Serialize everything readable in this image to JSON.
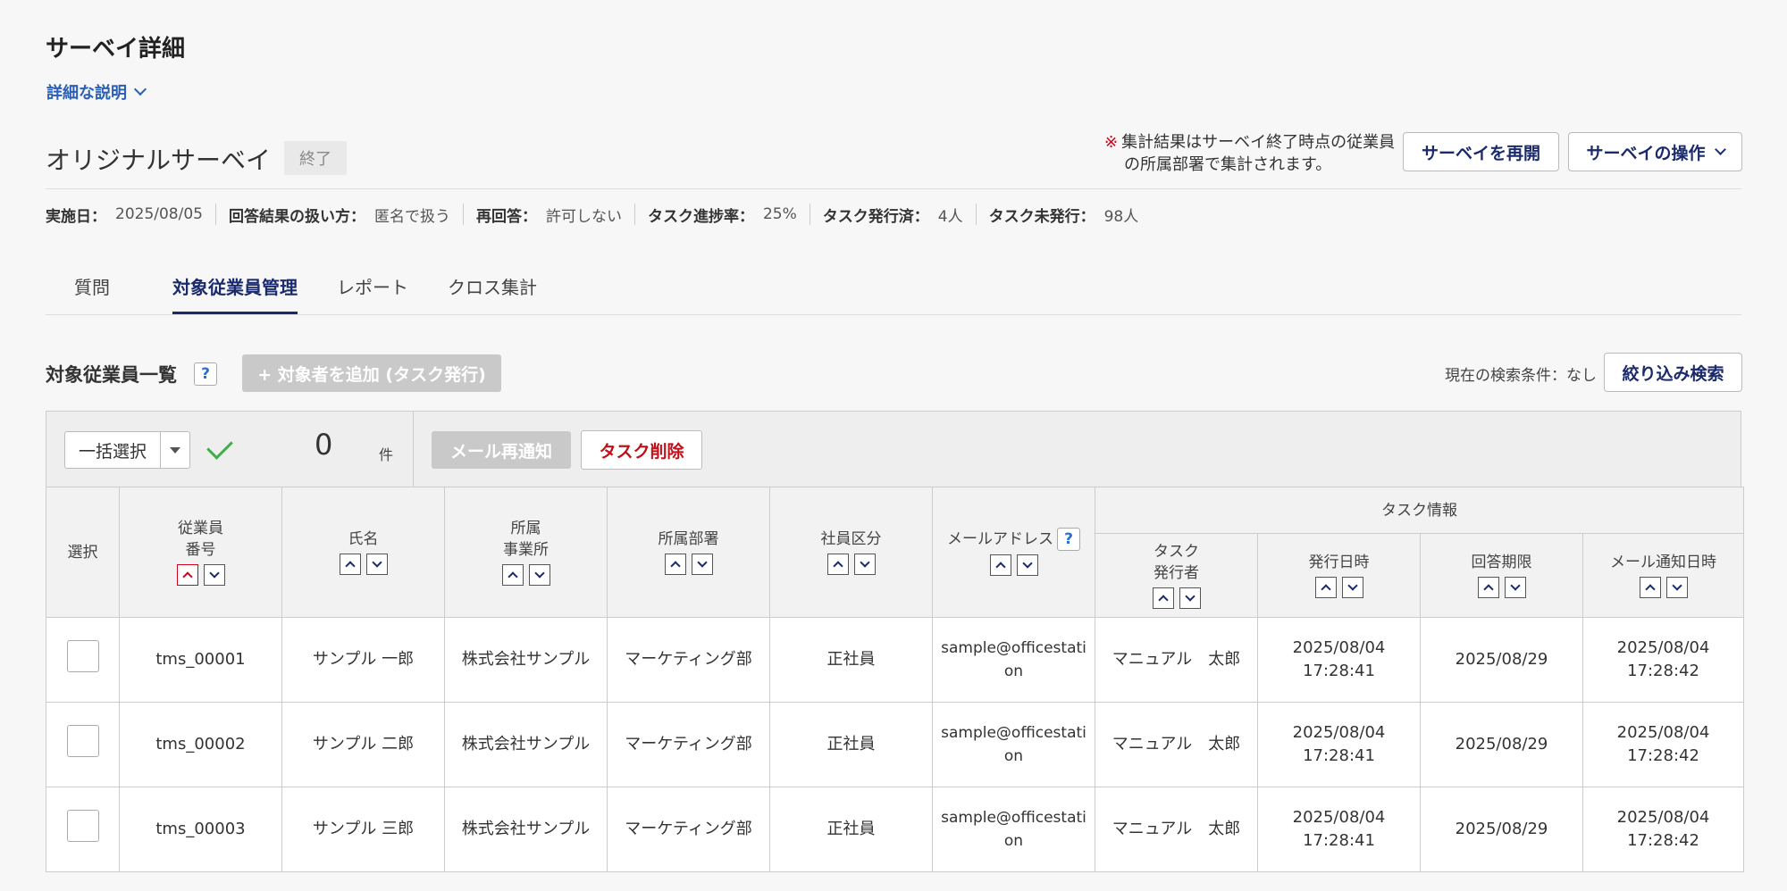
{
  "page": {
    "title": "サーベイ詳細",
    "description_toggle": "詳細な説明"
  },
  "survey": {
    "name": "オリジナルサーベイ",
    "status": "終了",
    "notice_mark": "※",
    "notice_line1": "集計結果はサーベイ終了時点の従業員",
    "notice_line2": "の所属部署で集計されます。",
    "reopen_label": "サーベイを再開",
    "ops_label": "サーベイの操作"
  },
  "meta": [
    {
      "key": "実施日：",
      "value": "2025/08/05"
    },
    {
      "key": "回答結果の扱い方：",
      "value": "匿名で扱う"
    },
    {
      "key": "再回答：",
      "value": "許可しない"
    },
    {
      "key": "タスク進捗率：",
      "value": "25%"
    },
    {
      "key": "タスク発行済：",
      "value": "4人"
    },
    {
      "key": "タスク未発行：",
      "value": "98人"
    }
  ],
  "tabs": [
    "質問",
    "対象従業員管理",
    "レポート",
    "クロス集計"
  ],
  "active_tab": "対象従業員管理",
  "section": {
    "title": "対象従業員一覧",
    "help": "?",
    "add_label": "+ 対象者を追加 (タスク発行)",
    "filter_status": "現在の検索条件：なし",
    "filter_button": "絞り込み検索"
  },
  "toolbar": {
    "bulk_select": "一括選択",
    "count": "0",
    "count_unit": "件",
    "resend_label": "メール再通知",
    "delete_label": "タスク削除"
  },
  "table": {
    "headers": {
      "select": "選択",
      "emp_no_1": "従業員",
      "emp_no_2": "番号",
      "name": "氏名",
      "office_1": "所属",
      "office_2": "事業所",
      "dept": "所属部署",
      "type": "社員区分",
      "email": "メールアドレス",
      "task_info": "タスク情報",
      "issuer_1": "タスク",
      "issuer_2": "発行者",
      "issued_at": "発行日時",
      "deadline": "回答期限",
      "notified_at": "メール通知日時"
    },
    "rows": [
      {
        "emp_no": "tms_00001",
        "name": "サンプル 一郎",
        "office": "株式会社サンプル",
        "dept": "マーケティング部",
        "type": "正社員",
        "email": "sample@officestation",
        "issuer": "マニュアル　太郎",
        "issued_date": "2025/08/04",
        "issued_time": "17:28:41",
        "deadline": "2025/08/29",
        "notified_date": "2025/08/04",
        "notified_time": "17:28:42"
      },
      {
        "emp_no": "tms_00002",
        "name": "サンプル 二郎",
        "office": "株式会社サンプル",
        "dept": "マーケティング部",
        "type": "正社員",
        "email": "sample@officestation",
        "issuer": "マニュアル　太郎",
        "issued_date": "2025/08/04",
        "issued_time": "17:28:41",
        "deadline": "2025/08/29",
        "notified_date": "2025/08/04",
        "notified_time": "17:28:42"
      },
      {
        "emp_no": "tms_00003",
        "name": "サンプル 三郎",
        "office": "株式会社サンプル",
        "dept": "マーケティング部",
        "type": "正社員",
        "email": "sample@officestation",
        "issuer": "マニュアル　太郎",
        "issued_date": "2025/08/04",
        "issued_time": "17:28:41",
        "deadline": "2025/08/29",
        "notified_date": "2025/08/04",
        "notified_time": "17:28:42"
      }
    ]
  },
  "colors": {
    "accent": "#1a2a6c",
    "link": "#2a5fb4",
    "danger": "#c0101a",
    "success": "#3fae49",
    "disabled": "#c9c9c9"
  }
}
